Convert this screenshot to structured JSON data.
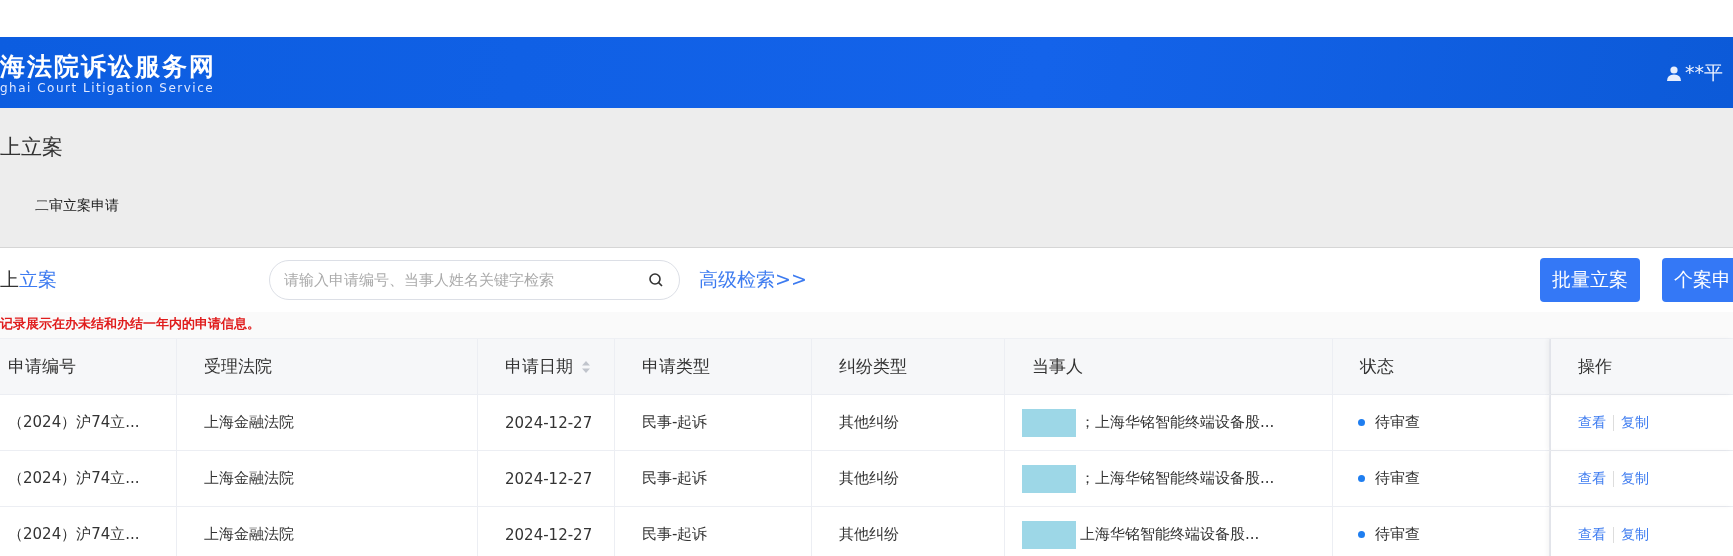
{
  "header": {
    "title": "海法院诉讼服务网",
    "subtitle": "ghai Court Litigation Service",
    "user": "**平"
  },
  "page_title": "上立案",
  "sub_nav": [
    {
      "label": "二审立案申请"
    }
  ],
  "toolbar": {
    "title_dark": "上",
    "title_link": "立案",
    "search": {
      "placeholder": "请输入申请编号、当事人姓名关键字检索"
    },
    "advanced_link": "高级检索>>",
    "buttons": [
      "批量立案",
      "个案申"
    ]
  },
  "notice": "记录展示在办未结和办结一年内的申请信息。",
  "table": {
    "columns": [
      {
        "label": "申请编号",
        "sortable": false
      },
      {
        "label": "受理法院",
        "sortable": false
      },
      {
        "label": "申请日期",
        "sortable": true
      },
      {
        "label": "申请类型",
        "sortable": false
      },
      {
        "label": "纠纷类型",
        "sortable": false
      },
      {
        "label": "当事人",
        "sortable": false
      },
      {
        "label": "状态",
        "sortable": false
      },
      {
        "label": "操作",
        "sortable": false
      }
    ],
    "rows": [
      {
        "number": "（2024）沪74立...",
        "court": "上海金融法院",
        "date": "2024-12-27",
        "apply_type": "民事-起诉",
        "dispute_type": "其他纠纷",
        "parties": "；上海华铭智能终端设备股...",
        "redacted": true,
        "status": "待审查",
        "color": "#1f7ef0",
        "actions": [
          "查看",
          "复制"
        ]
      },
      {
        "number": "（2024）沪74立...",
        "court": "上海金融法院",
        "date": "2024-12-27",
        "apply_type": "民事-起诉",
        "dispute_type": "其他纠纷",
        "parties": "；上海华铭智能终端设备股...",
        "redacted": true,
        "status": "待审查",
        "color": "#1f7ef0",
        "actions": [
          "查看",
          "复制"
        ]
      },
      {
        "number": "（2024）沪74立...",
        "court": "上海金融法院",
        "date": "2024-12-27",
        "apply_type": "民事-起诉",
        "dispute_type": "其他纠纷",
        "parties": "上海华铭智能终端设备股...",
        "redacted": true,
        "status": "待审查",
        "color": "#1f7ef0",
        "actions": [
          "查看",
          "复制"
        ]
      }
    ]
  }
}
